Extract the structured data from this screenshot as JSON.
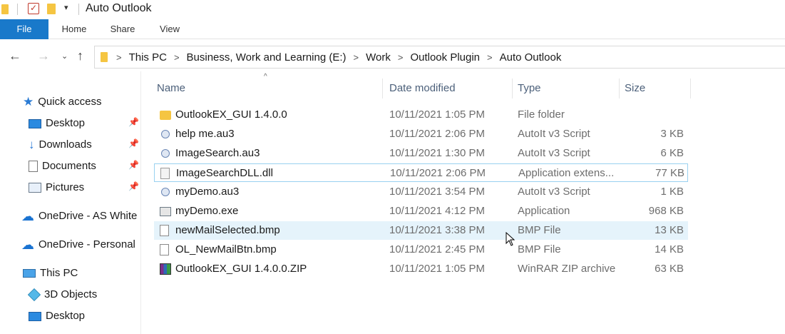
{
  "window": {
    "title": "Auto Outlook"
  },
  "ribbon": {
    "tabs": [
      "File",
      "Home",
      "Share",
      "View"
    ]
  },
  "address": {
    "crumbs": [
      "This PC",
      "Business, Work and Learning (E:)",
      "Work",
      "Outlook Plugin",
      "Auto Outlook"
    ]
  },
  "navpane": {
    "quick_access": "Quick access",
    "pinned": [
      "Desktop",
      "Downloads",
      "Documents",
      "Pictures"
    ],
    "onedrive_work": "OneDrive - AS White",
    "onedrive_personal": "OneDrive - Personal",
    "this_pc": "This PC",
    "pc_items": [
      "3D Objects",
      "Desktop"
    ]
  },
  "columns": {
    "name": "Name",
    "date": "Date modified",
    "type": "Type",
    "size": "Size"
  },
  "files": [
    {
      "name": "OutlookEX_GUI 1.4.0.0",
      "date": "10/11/2021 1:05 PM",
      "type": "File folder",
      "size": "",
      "icon": "folder-icon"
    },
    {
      "name": "help me.au3",
      "date": "10/11/2021 2:06 PM",
      "type": "AutoIt v3 Script",
      "size": "3 KB",
      "icon": "autoit-script-icon"
    },
    {
      "name": "ImageSearch.au3",
      "date": "10/11/2021 1:30 PM",
      "type": "AutoIt v3 Script",
      "size": "6 KB",
      "icon": "autoit-script-icon"
    },
    {
      "name": "ImageSearchDLL.dll",
      "date": "10/11/2021 2:06 PM",
      "type": "Application extens...",
      "size": "77 KB",
      "icon": "dll-file-icon"
    },
    {
      "name": "myDemo.au3",
      "date": "10/11/2021 3:54 PM",
      "type": "AutoIt v3 Script",
      "size": "1 KB",
      "icon": "autoit-script-icon"
    },
    {
      "name": "myDemo.exe",
      "date": "10/11/2021 4:12 PM",
      "type": "Application",
      "size": "968 KB",
      "icon": "exe-file-icon"
    },
    {
      "name": "newMailSelected.bmp",
      "date": "10/11/2021 3:38 PM",
      "type": "BMP File",
      "size": "13 KB",
      "icon": "bmp-file-icon"
    },
    {
      "name": "OL_NewMailBtn.bmp",
      "date": "10/11/2021 2:45 PM",
      "type": "BMP File",
      "size": "14 KB",
      "icon": "bmp-file-icon"
    },
    {
      "name": "OutlookEX_GUI 1.4.0.0.ZIP",
      "date": "10/11/2021 1:05 PM",
      "type": "WinRAR ZIP archive",
      "size": "63 KB",
      "icon": "zip-archive-icon"
    }
  ],
  "colors": {
    "accent": "#1979ca",
    "hover_row": "#e5f3fb",
    "header_text": "#4c607a"
  }
}
